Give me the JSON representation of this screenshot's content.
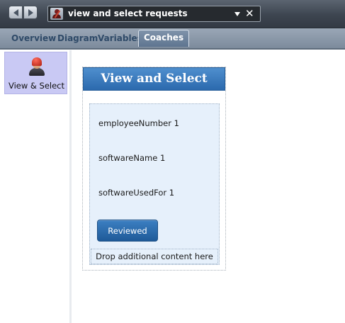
{
  "toolbar": {
    "back_icon": "arrow-left-icon",
    "forward_icon": "arrow-right-icon",
    "title": "view and select requests",
    "dropdown_icon": "chevron-down-icon",
    "close_symbol": "✕"
  },
  "tabs": [
    {
      "label": "Overview",
      "active": false
    },
    {
      "label": "Diagram",
      "active": false
    },
    {
      "label": "Variables",
      "active": false
    },
    {
      "label": "Coaches",
      "active": true
    }
  ],
  "sidebar": {
    "items": [
      {
        "label": "View & Select",
        "icon": "user-coach-icon",
        "selected": true
      }
    ]
  },
  "coach": {
    "title": "View and Select",
    "fields": [
      "employeeNumber 1",
      "softwareName 1",
      "softwareUsedFor 1"
    ],
    "button_label": "Reviewed",
    "drop_hint": "Drop additional content here"
  },
  "colors": {
    "header_blue": "#2b69ad",
    "button_blue": "#1f5a98",
    "palette_selected": "#c9c9f4",
    "section_bg": "#e6f0fb"
  }
}
